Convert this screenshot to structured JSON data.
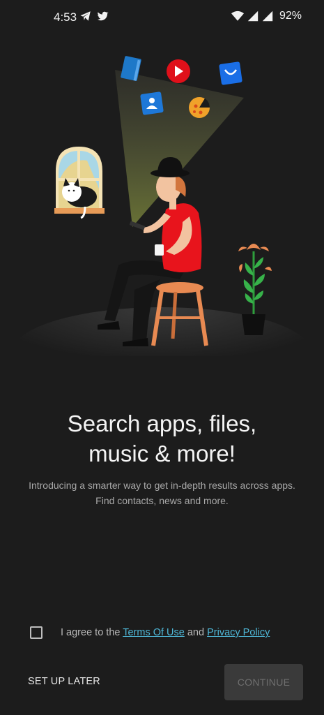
{
  "status_bar": {
    "time": "4:53",
    "battery": "92%",
    "left_icons": [
      "telegram-icon",
      "twitter-icon"
    ],
    "right_icons": [
      "wifi-icon",
      "cell-signal-icon",
      "cell-signal-icon"
    ]
  },
  "onboarding": {
    "headline_line1": "Search apps, files,",
    "headline_line2": "music & more!",
    "subtitle_line1": "Introducing a smarter way to get in-depth results across apps.",
    "subtitle_line2": "Find contacts, news and more."
  },
  "agreement": {
    "prefix": "I agree to the ",
    "terms_link": "Terms Of Use",
    "conjunction": " and ",
    "privacy_link": "Privacy Policy",
    "checked": false
  },
  "actions": {
    "setup_later_label": "SET UP LATER",
    "continue_label": "CONTINUE"
  },
  "colors": {
    "background": "#1c1c1c",
    "link": "#4fb8d8",
    "shirt": "#e8141c",
    "continue_disabled_bg": "#3a3a3a"
  }
}
